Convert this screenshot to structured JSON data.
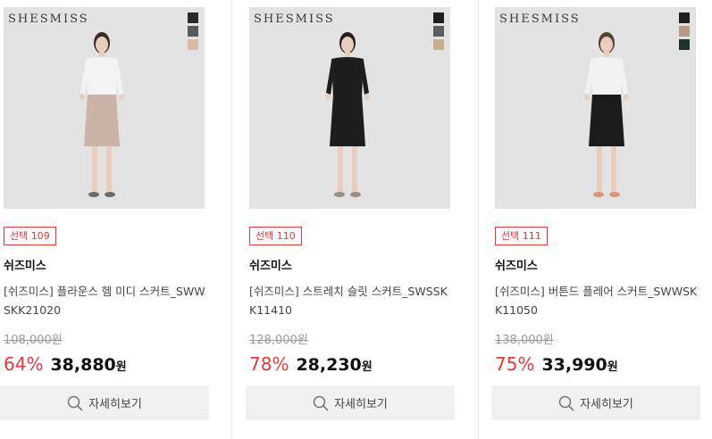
{
  "products": [
    {
      "brandmark": "SHESMISS",
      "swatches": [
        "#2a2a2a",
        "#555a5e",
        "#d8bca6"
      ],
      "outfit": {
        "top": "#f3f3f3",
        "bottom": "#cbb3a8",
        "hair": "#3c2c24",
        "shoe": "#6b6b6b"
      },
      "badge": "선택 109",
      "brand": "쉬즈미스",
      "name": "[쉬즈미스] 플라운스 헴 미디 스커트_SWWSKK21020",
      "original_price": "108,000",
      "original_unit": "원",
      "discount": "64%",
      "price": "38,880",
      "price_unit": "원",
      "detail_label": "자세히보기"
    },
    {
      "brandmark": "SHESMISS",
      "swatches": [
        "#1e1e1e",
        "#5a5e60",
        "#c9ad90"
      ],
      "outfit": {
        "top": "#1d1d1f",
        "bottom": "#1d1d1f",
        "hair": "#2a1f1a",
        "shoe": "#9a8f88"
      },
      "badge": "선택 110",
      "brand": "쉬즈미스",
      "name": "[쉬즈미스] 스트레치 슬릿 스커트_SWSSKK11410",
      "original_price": "128,000",
      "original_unit": "원",
      "discount": "78%",
      "price": "28,230",
      "price_unit": "원",
      "detail_label": "자세히보기"
    },
    {
      "brandmark": "SHESMISS",
      "swatches": [
        "#1e1e1e",
        "#b89a88",
        "#1f3230"
      ],
      "outfit": {
        "top": "#f2f2f2",
        "bottom": "#1b1b1b",
        "hair": "#5a3e2e",
        "shoe": "#d9957a"
      },
      "badge": "선택 111",
      "brand": "쉬즈미스",
      "name": "[쉬즈미스] 버튼드 플레어 스커트_SWWSKK11050",
      "original_price": "138,000",
      "original_unit": "원",
      "discount": "75%",
      "price": "33,990",
      "price_unit": "원",
      "detail_label": "자세히보기"
    }
  ]
}
